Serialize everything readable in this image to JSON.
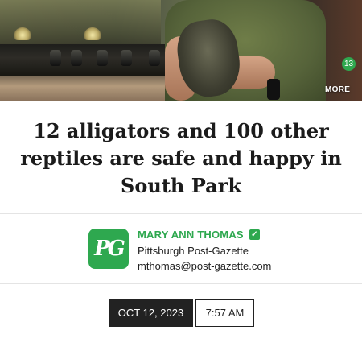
{
  "hero": {
    "alt": "Person in green shirt holding a baby alligator",
    "comment_count": "13",
    "more_label": "MORE"
  },
  "article": {
    "headline": "12 alligators and 100 other reptiles are safe and happy in South Park"
  },
  "byline": {
    "logo_text": "PG",
    "author": "MARY ANN THOMAS",
    "publication": "Pittsburgh Post-Gazette",
    "email": "mthomas@post-gazette.com",
    "verified_icon": "check-icon"
  },
  "meta": {
    "date": "OCT 12, 2023",
    "time": "7:57 AM"
  },
  "colors": {
    "brand_green": "#2ea84f",
    "date_bg": "#222222"
  }
}
